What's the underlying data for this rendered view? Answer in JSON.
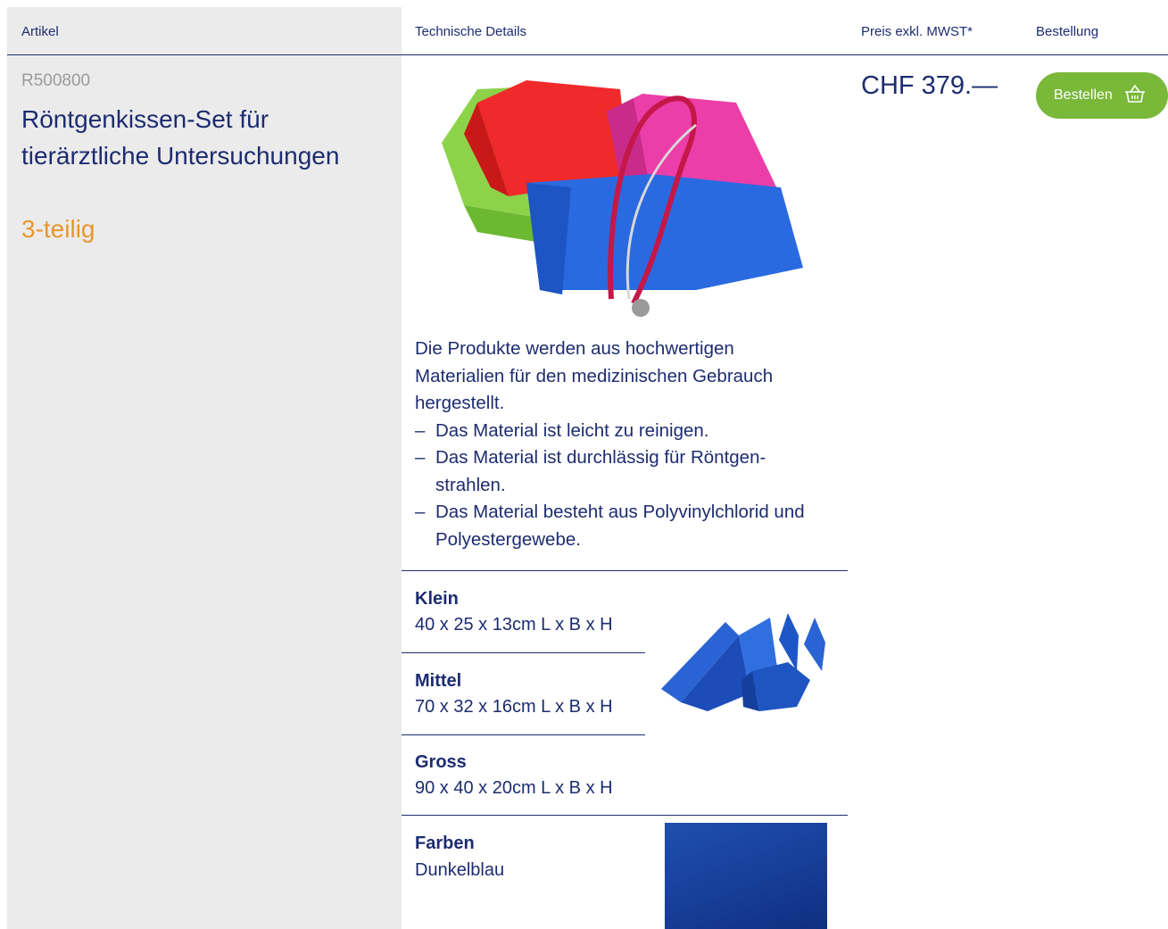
{
  "table_header": {
    "artikel": "Artikel",
    "details": "Technische Details",
    "preis": "Preis exkl. MWST*",
    "bestellung": "Bestellung"
  },
  "product": {
    "sku": "R500800",
    "title": "Röntgenkissen-Set für tierärztliche Untersuchungen",
    "subtitle": "3-teilig",
    "price": "CHF 379.—",
    "order_button": "Bestellen",
    "description": "Die Produkte werden aus hochwertigen Materialien für den medizinischen Gebrauch hergestellt.",
    "features": [
      "Das Material ist leicht zu reinigen.",
      "Das Material ist durchlässig für Röntgen­strahlen.",
      "Das Material besteht aus Polyvinylchlorid und Polyestergewebe."
    ],
    "sizes": [
      {
        "label": "Klein",
        "value": "40 x 25 x 13cm L x B x H"
      },
      {
        "label": "Mittel",
        "value": "70 x 32 x 16cm L x B x H"
      },
      {
        "label": "Gross",
        "value": "90 x 40 x 20cm L x B x H"
      }
    ],
    "colors": {
      "label": "Farben",
      "value": "Dunkelblau"
    }
  },
  "icons": {
    "cart": "basket-icon"
  },
  "theme": {
    "navy": "#1d2c70",
    "orange": "#e8962a",
    "green": "#7ab83a",
    "grey_bg": "#ebebeb",
    "sku_grey": "#9a9a9a"
  }
}
